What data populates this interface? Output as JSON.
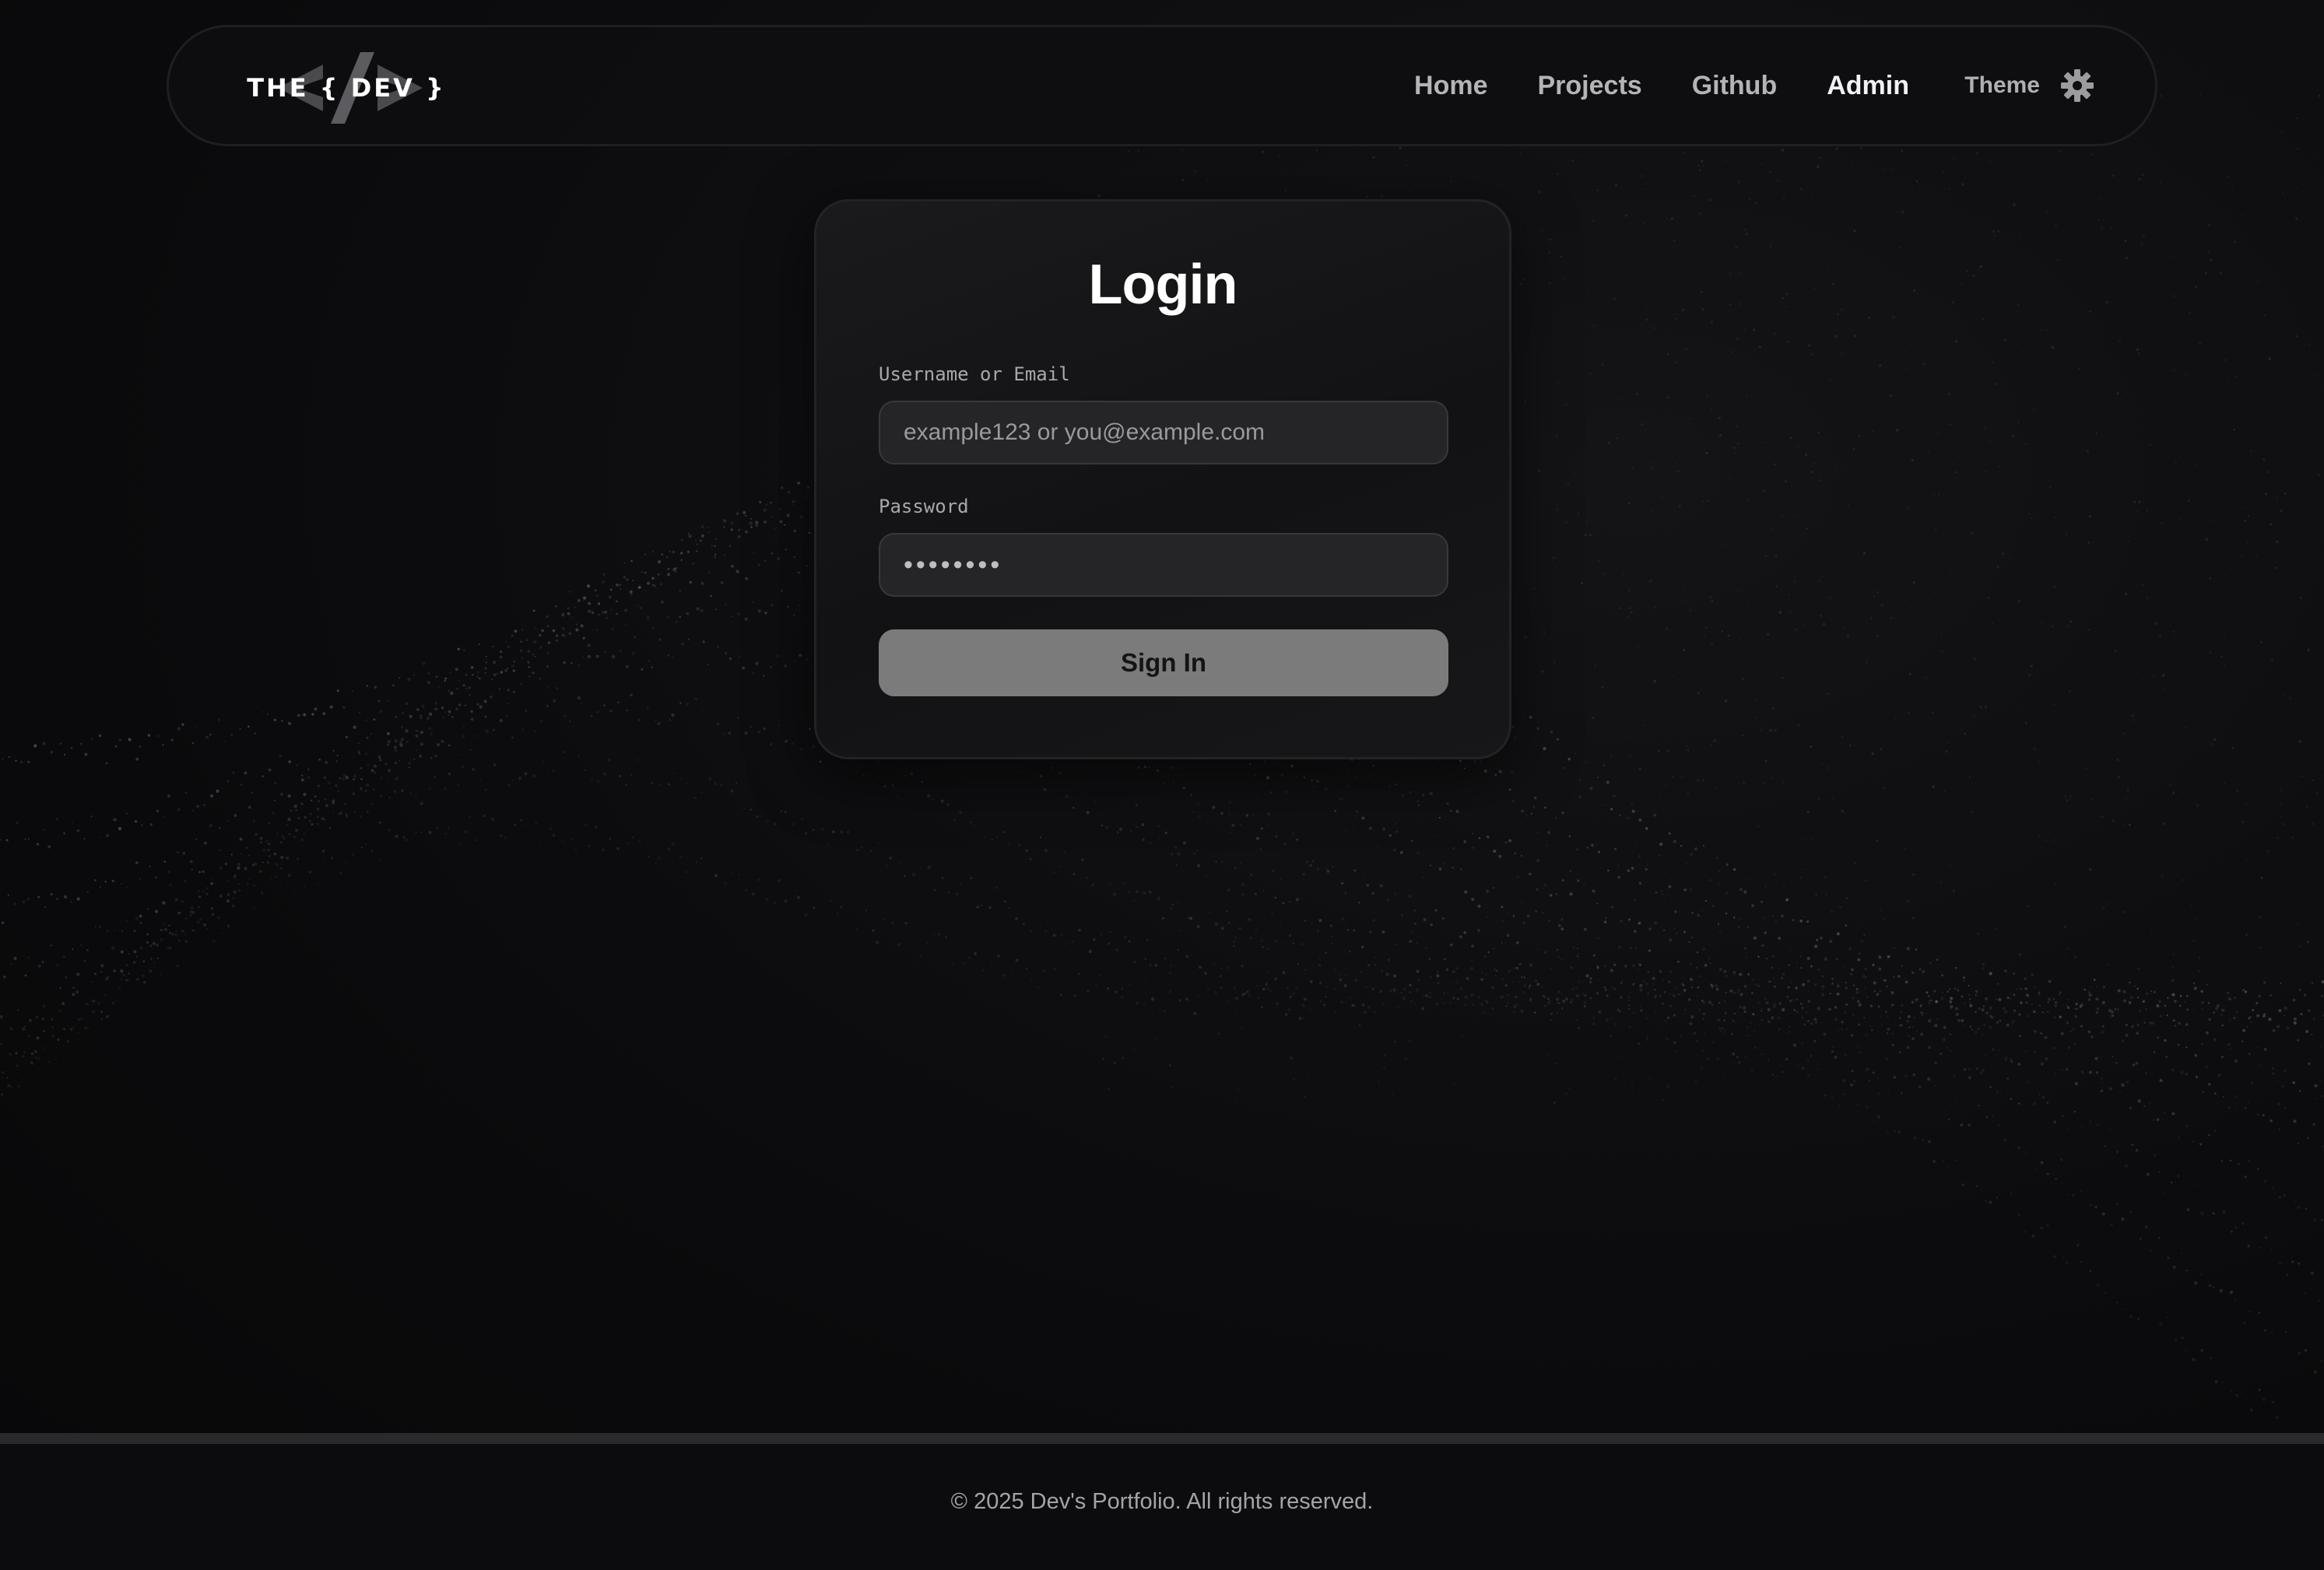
{
  "nav": {
    "logo_text": "THE { DEV }",
    "links": [
      {
        "label": "Home",
        "active": false
      },
      {
        "label": "Projects",
        "active": false
      },
      {
        "label": "Github",
        "active": false
      },
      {
        "label": "Admin",
        "active": true
      }
    ],
    "theme_label": "Theme",
    "theme_icon": "gear-icon"
  },
  "login": {
    "title": "Login",
    "username_label": "Username or Email",
    "username_placeholder": "example123 or you@example.com",
    "username_value": "",
    "password_label": "Password",
    "password_value": "••••••••",
    "submit_label": "Sign In"
  },
  "footer": {
    "text": "© 2025 Dev's Portfolio. All rights reserved."
  },
  "colors": {
    "background": "#0b0b0d",
    "card": "#151517",
    "input": "#252528",
    "button": "#7b7b7c",
    "text_primary": "#ffffff",
    "text_muted": "#a8a8ac"
  }
}
